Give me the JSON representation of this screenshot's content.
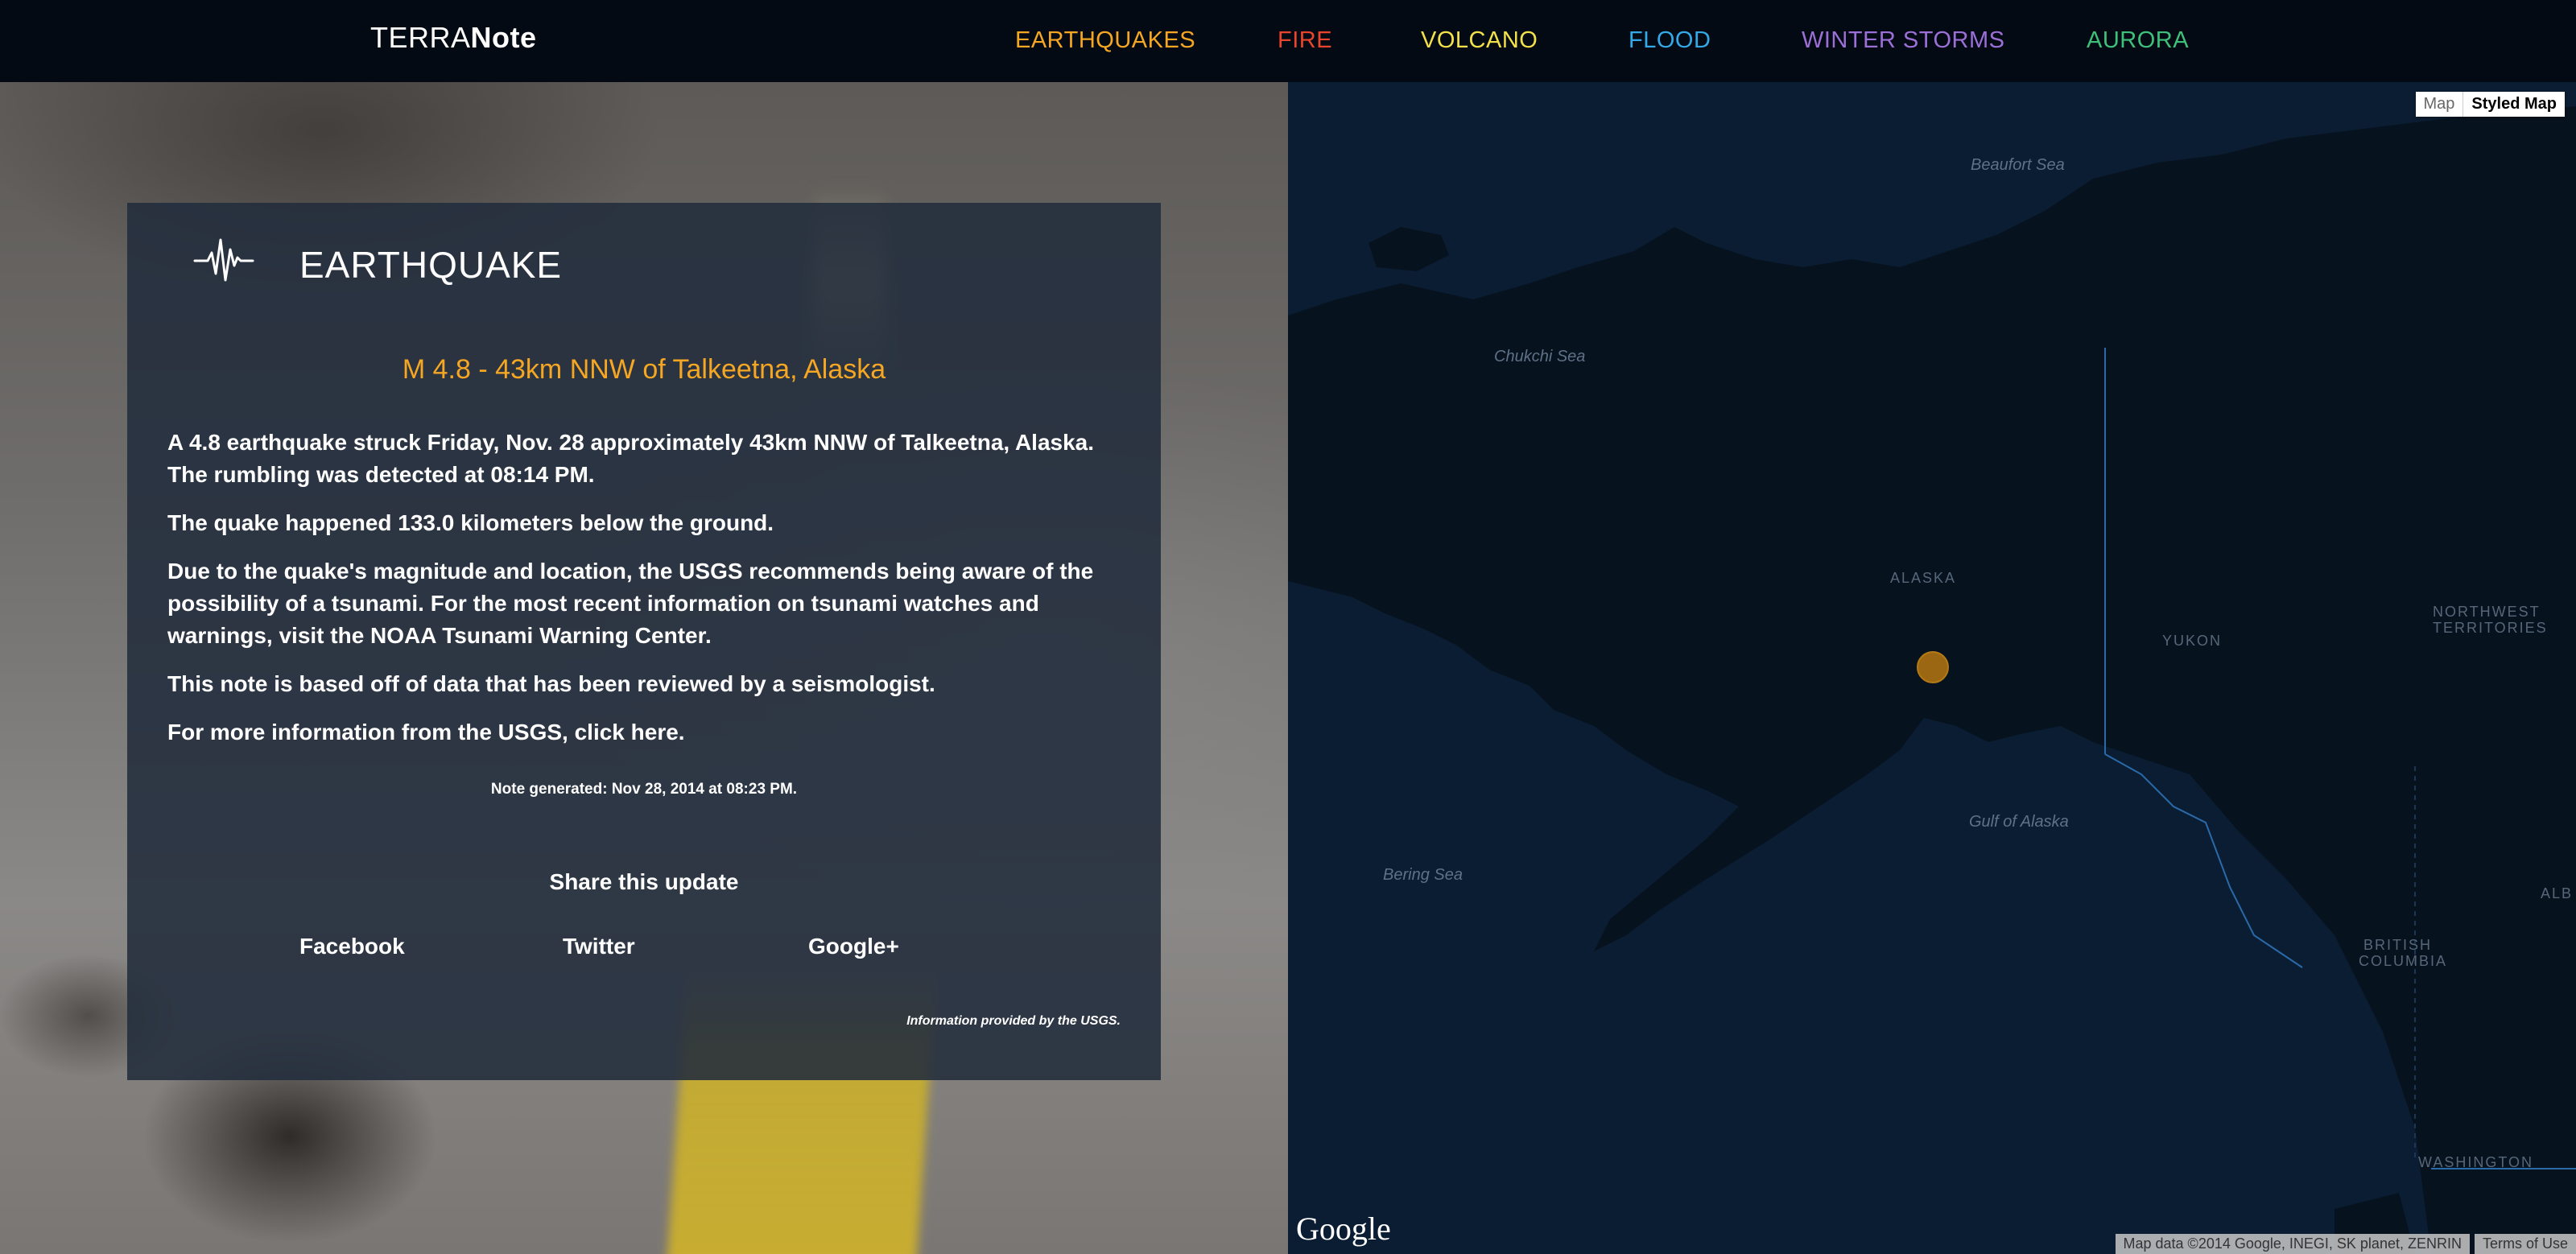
{
  "brand": {
    "light": "TERRA",
    "bold": "Note"
  },
  "nav": [
    {
      "label": "EARTHQUAKES",
      "color": "#f5a623"
    },
    {
      "label": "FIRE",
      "color": "#e8452c"
    },
    {
      "label": "VOLCANO",
      "color": "#f3e04a"
    },
    {
      "label": "FLOOD",
      "color": "#35a9e8"
    },
    {
      "label": "WINTER STORMS",
      "color": "#9b6fd6"
    },
    {
      "label": "AURORA",
      "color": "#3fc07a"
    }
  ],
  "note": {
    "icon": "seismograph-icon",
    "heading": "EARTHQUAKE",
    "title": "M 4.8 - 43km NNW of Talkeetna, Alaska",
    "title_color": "#f5a623",
    "paragraphs": [
      "A 4.8 earthquake struck Friday, Nov. 28 approximately 43km NNW of Talkeetna, Alaska. The rumbling was detected at 08:14 PM.",
      "The quake happened 133.0 kilometers below the ground.",
      "Due to the quake's magnitude and location, the USGS recommends being aware of the possibility of a tsunami. For the most recent information on tsunami watches and warnings, visit the NOAA Tsunami Warning Center.",
      "This note is based off of data that has been reviewed by a seismologist.",
      "For more information from the USGS, click here."
    ],
    "generated": "Note generated: Nov 28, 2014 at 08:23 PM.",
    "share_title": "Share this update",
    "share": [
      "Facebook",
      "Twitter",
      "Google+"
    ],
    "credit": "Information provided by the USGS."
  },
  "map": {
    "type_buttons": {
      "map": "Map",
      "styled": "Styled Map"
    },
    "labels": {
      "beaufort": "Beaufort Sea",
      "chukchi": "Chukchi Sea",
      "alaska": "ALASKA",
      "yukon": "YUKON",
      "nwt_1": "NORTHWEST",
      "nwt_2": "TERRITORIES",
      "gulf": "Gulf of Alaska",
      "bering": "Bering Sea",
      "bc_1": "BRITISH",
      "bc_2": "COLUMBIA",
      "alb": "ALB",
      "washington": "WASHINGTON"
    },
    "logo": "Google",
    "attribution": "Map data ©2014 Google, INEGI, SK planet, ZENRIN",
    "terms": "Terms of Use",
    "marker_color": "#9b6712"
  }
}
